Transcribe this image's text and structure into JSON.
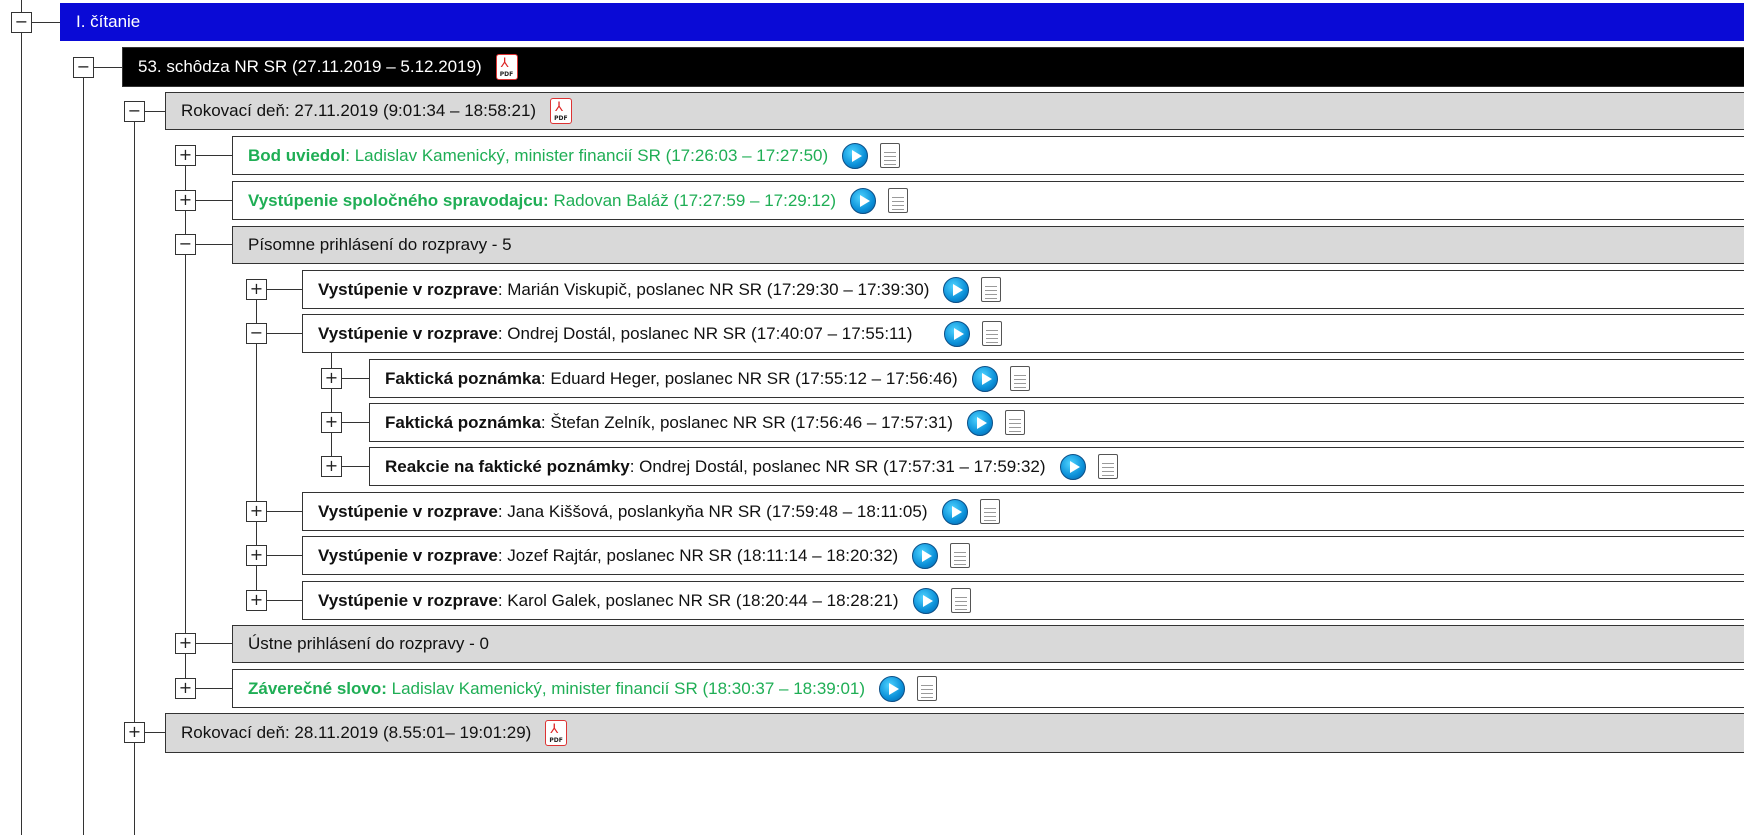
{
  "tree": {
    "collapse_symbol": "−",
    "expand_symbol": "+",
    "reading": "I. čítanie",
    "session": "53. schôdza NR SR (27.11.2019 – 5.12.2019)",
    "pdf_label": "PDF",
    "day1": "Rokovací deň: 27.11.2019 (9:01:34 – 18:58:21)",
    "items": [
      {
        "bold": "Bod uviedol",
        "text": ": Ladislav Kamenický, minister financií SR (17:26:03 – 17:27:50)"
      },
      {
        "bold": "Vystúpenie spoločného spravodajcu:",
        "text": " Radovan Baláž (17:27:59 – 17:29:12)"
      },
      {
        "text": "Písomne prihlásení do rozpravy - 5"
      },
      {
        "bold": "Vystúpenie v rozprave",
        "text": ": Marián Viskupič, poslanec NR SR (17:29:30 – 17:39:30)"
      },
      {
        "bold": "Vystúpenie v rozprave",
        "text": ": Ondrej Dostál, poslanec NR SR (17:40:07 – 17:55:11)"
      },
      {
        "bold": "Faktická poznámka",
        "text": ": Eduard Heger, poslanec NR SR (17:55:12 – 17:56:46)"
      },
      {
        "bold": "Faktická poznámka",
        "text": ": Štefan Zelník, poslanec NR SR (17:56:46 – 17:57:31)"
      },
      {
        "bold": "Reakcie na faktické poznámky",
        "text": ": Ondrej Dostál, poslanec NR SR (17:57:31 – 17:59:32)"
      },
      {
        "bold": "Vystúpenie v rozprave",
        "text": ": Jana Kiššová, poslankyňa NR SR (17:59:48 – 18:11:05)"
      },
      {
        "bold": "Vystúpenie v rozprave",
        "text": ": Jozef Rajtár, poslanec NR SR (18:11:14 – 18:20:32)"
      },
      {
        "bold": "Vystúpenie v rozprave",
        "text": ": Karol Galek, poslanec NR SR (18:20:44 – 18:28:21)"
      },
      {
        "text": "Ústne prihlásení do rozpravy - 0"
      },
      {
        "bold": "Záverečné slovo:",
        "text": " Ladislav Kamenický, minister financií SR (18:30:37 – 18:39:01)"
      }
    ],
    "day2": "Rokovací deň: 28.11.2019 (8.55:01– 19:01:29)"
  },
  "colors": {
    "reading_bg": "#0a0ad6",
    "session_bg": "#000000",
    "day_bg": "#d9d9d9",
    "green_text": "#1fae55"
  },
  "icons": {
    "play": "play-video-icon",
    "document": "transcript-document-icon",
    "pdf": "pdf-file-icon"
  }
}
